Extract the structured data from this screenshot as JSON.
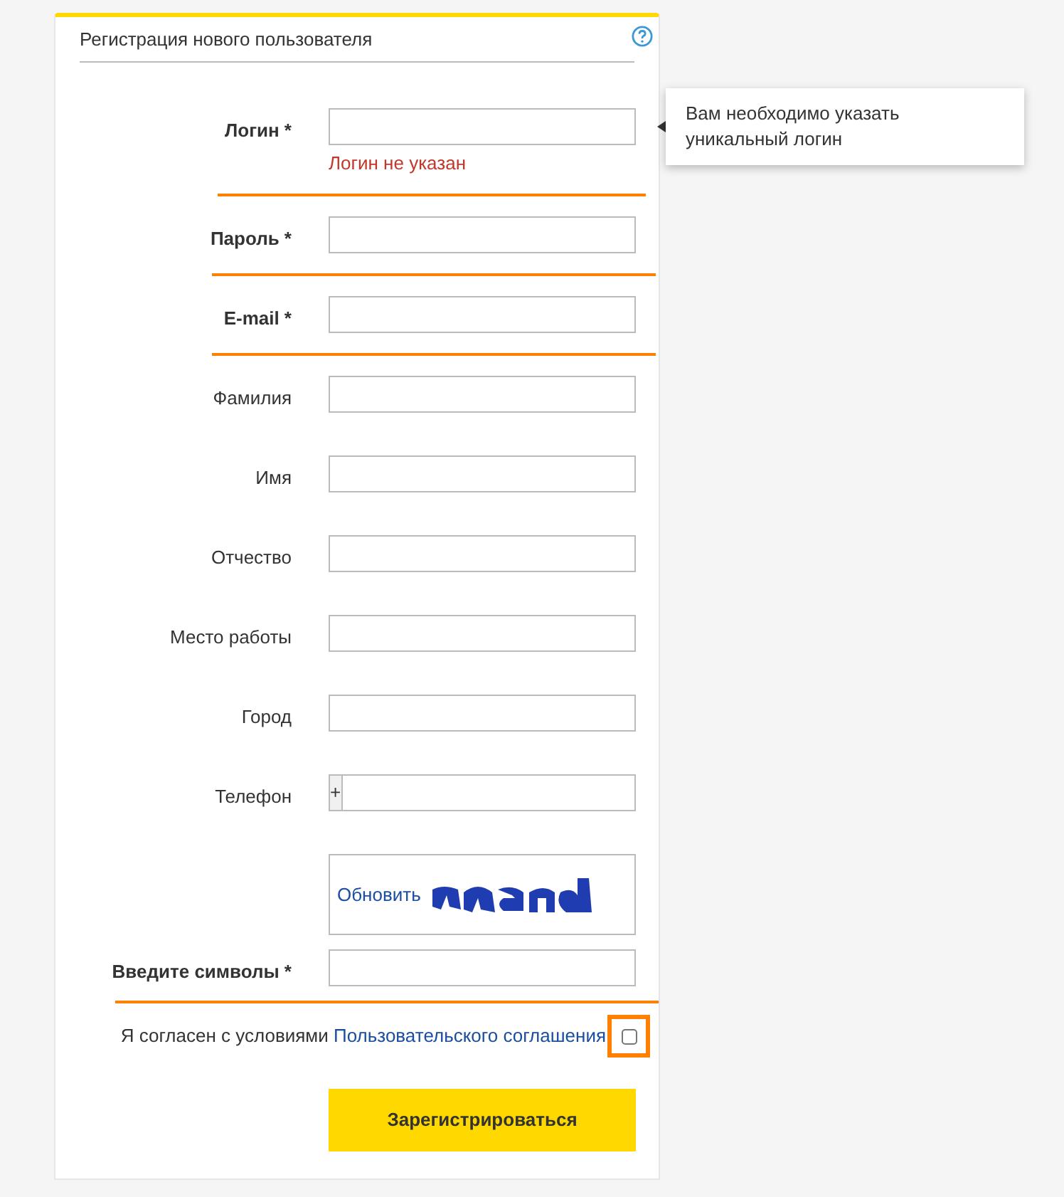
{
  "form": {
    "title": "Регистрация нового пользователя"
  },
  "fields": [
    {
      "kind": "text",
      "label": "Логин *",
      "required": true,
      "highlighted": true,
      "error": "Логин не указан"
    },
    {
      "kind": "text",
      "label": "Пароль *",
      "required": true,
      "highlighted": true
    },
    {
      "kind": "text",
      "label": "E-mail *",
      "required": true,
      "highlighted": true
    },
    {
      "kind": "text",
      "label": "Фамилия",
      "required": false,
      "highlighted": false
    },
    {
      "kind": "text",
      "label": "Имя",
      "required": false,
      "highlighted": false
    },
    {
      "kind": "text",
      "label": "Отчество",
      "required": false,
      "highlighted": false
    },
    {
      "kind": "text",
      "label": "Место работы",
      "required": false,
      "highlighted": false
    },
    {
      "kind": "text",
      "label": "Город",
      "required": false,
      "highlighted": false
    },
    {
      "kind": "phone",
      "label": "Телефон",
      "required": false,
      "highlighted": false,
      "prefix": "+"
    },
    {
      "kind": "captcha",
      "label": "Введите символы *",
      "required": true,
      "highlighted": true,
      "refresh": "Обновить"
    }
  ],
  "tooltip": {
    "text": "Вам необходимо указать уникальный логин"
  },
  "agreement": {
    "text": "Я согласен с условиями",
    "link": "Пользовательского соглашения",
    "checked": false,
    "highlighted": true
  },
  "submit": "Зарегистрироваться"
}
